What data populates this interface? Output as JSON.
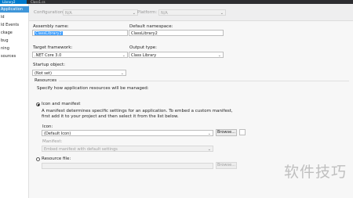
{
  "tabs": [
    "Library2",
    "Class1.cs"
  ],
  "sidebar": {
    "items": [
      "Application",
      "ld",
      "ld Events",
      "ckage",
      "bug",
      "ning",
      "sources"
    ]
  },
  "config": {
    "configuration_label": "Configuration:",
    "configuration_value": "N/A",
    "platform_label": "Platform:",
    "platform_value": "N/A"
  },
  "fields": {
    "assembly_name_label": "Assembly name:",
    "assembly_name_value": "ClassLibrary2",
    "default_namespace_label": "Default namespace:",
    "default_namespace_value": "ClassLibrary2",
    "target_framework_label": "Target framework:",
    "target_framework_value": ".NET Core 3.0",
    "output_type_label": "Output type:",
    "output_type_value": "Class Library",
    "startup_object_label": "Startup object:",
    "startup_object_value": "(Not set)"
  },
  "resources": {
    "title": "Resources",
    "description": "Specify how application resources will be managed:",
    "icon_manifest_label": "Icon and manifest",
    "icon_manifest_desc": "A manifest determines specific settings for an application. To embed a custom manifest, first add it to your project and then select it from the list below.",
    "icon_label": "Icon:",
    "icon_value": "(Default Icon)",
    "browse_label": "Browse...",
    "manifest_label": "Manifest:",
    "manifest_value": "Embed manifest with default settings",
    "resource_file_label": "Resource file:",
    "browse2_label": "Browse..."
  },
  "watermark": "软件技巧"
}
